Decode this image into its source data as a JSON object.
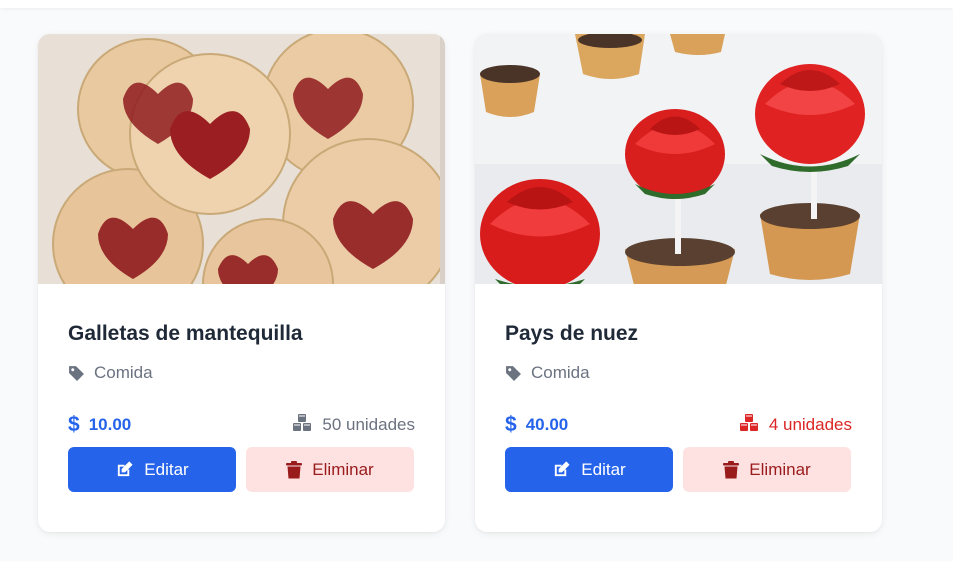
{
  "products": [
    {
      "name": "Galletas de mantequilla",
      "category": "Comida",
      "currency_symbol": "$",
      "price": "10.00",
      "stock": "50 unidades",
      "stock_status": "normal",
      "edit_label": "Editar",
      "delete_label": "Eliminar",
      "image": "jam-heart-cookies"
    },
    {
      "name": "Pays de nuez",
      "category": "Comida",
      "currency_symbol": "$",
      "price": "40.00",
      "stock": "4 unidades",
      "stock_status": "low",
      "edit_label": "Editar",
      "delete_label": "Eliminar",
      "image": "strawberry-rose-tarts"
    }
  ],
  "icons": {
    "category": "tag-icon",
    "stock": "cubes-icon",
    "price": "dollar-icon",
    "edit": "edit-icon",
    "delete": "trash-icon"
  },
  "colors": {
    "primary": "#2563eb",
    "danger_text": "#991b1b",
    "danger_bg": "#fee2e2",
    "low_stock": "#dc2626",
    "muted": "#6b7280",
    "title": "#1f2937"
  }
}
